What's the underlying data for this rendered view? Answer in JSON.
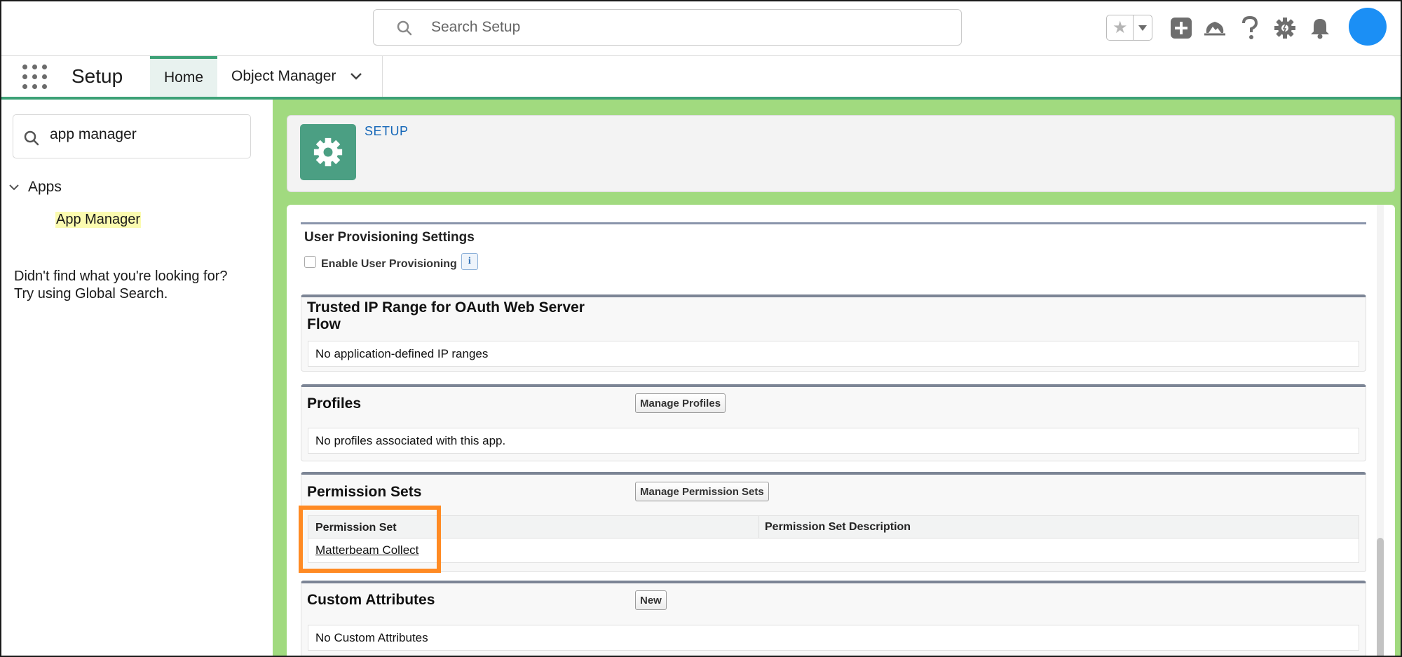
{
  "header": {
    "search_placeholder": "Search Setup",
    "icons": [
      "search-icon",
      "favorites-star-icon",
      "chevron-down-icon",
      "global-actions-plus-icon",
      "trailhead-icon",
      "help-icon",
      "setup-gear-icon",
      "notifications-bell-icon"
    ],
    "avatar_color": "#1b8ff5"
  },
  "nav": {
    "app_name": "Setup",
    "tabs": [
      {
        "label": "Home",
        "active": true
      },
      {
        "label": "Object Manager",
        "active": false
      }
    ],
    "accent_color": "#3da177"
  },
  "sidebar": {
    "quick_find_value": "app manager",
    "tree": {
      "group": "Apps",
      "item": "App Manager"
    },
    "not_found_line1": "Didn't find what you're looking for?",
    "not_found_line2": "Try using Global Search."
  },
  "page_header": {
    "label": "SETUP",
    "icon": "setup-gear-icon"
  },
  "sections": {
    "user_provisioning": {
      "title": "User Provisioning Settings",
      "checkbox_label": "Enable User Provisioning",
      "checked": false,
      "info_glyph": "i"
    },
    "trusted_ip": {
      "title_line1": "Trusted IP Range for OAuth Web Server",
      "title_line2": "Flow",
      "empty_text": "No application-defined IP ranges"
    },
    "profiles": {
      "title": "Profiles",
      "button": "Manage Profiles",
      "empty_text": "No profiles associated with this app."
    },
    "permission_sets": {
      "title": "Permission Sets",
      "button": "Manage Permission Sets",
      "columns": [
        "Permission Set",
        "Permission Set Description"
      ],
      "rows": [
        {
          "name": "Matterbeam Collect",
          "description": ""
        }
      ]
    },
    "custom_attributes": {
      "title": "Custom Attributes",
      "button": "New",
      "empty_text": "No Custom Attributes"
    }
  },
  "colors": {
    "main_background": "#a1da7f",
    "highlight_box": "#ff8a23",
    "setup_label": "#1567b8"
  }
}
